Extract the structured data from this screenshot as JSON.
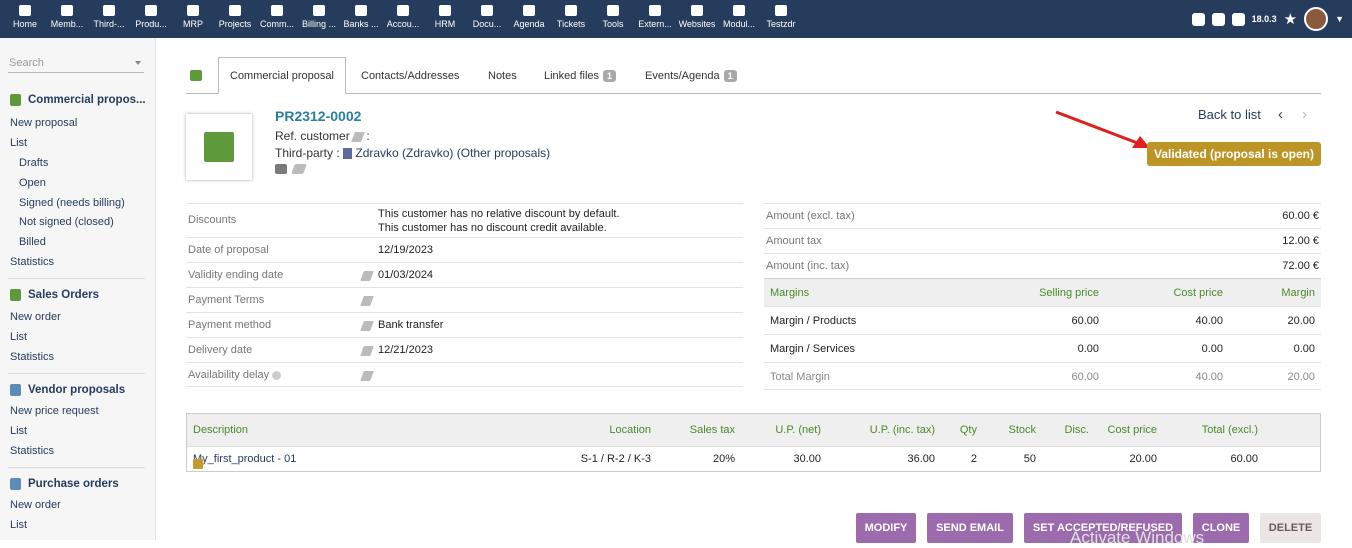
{
  "topmenu": [
    {
      "label": "Home",
      "icon": "home-icon"
    },
    {
      "label": "Memb...",
      "icon": "member-icon"
    },
    {
      "label": "Third-...",
      "icon": "building-icon"
    },
    {
      "label": "Produ...",
      "icon": "cube-icon"
    },
    {
      "label": "MRP",
      "icon": "cogs-icon"
    },
    {
      "label": "Projects",
      "icon": "sitemap-icon"
    },
    {
      "label": "Comm...",
      "icon": "suitcase-icon"
    },
    {
      "label": "Billing ...",
      "icon": "coins-icon"
    },
    {
      "label": "Banks ...",
      "icon": "bank-icon"
    },
    {
      "label": "Accou...",
      "icon": "search-dollar-icon"
    },
    {
      "label": "HRM",
      "icon": "user-tie-icon"
    },
    {
      "label": "Docu...",
      "icon": "folder-icon"
    },
    {
      "label": "Agenda",
      "icon": "calendar-icon"
    },
    {
      "label": "Tickets",
      "icon": "ticket-icon"
    },
    {
      "label": "Tools",
      "icon": "wrench-icon"
    },
    {
      "label": "Extern...",
      "icon": "external-link-icon"
    },
    {
      "label": "Websites",
      "icon": "globe-icon"
    },
    {
      "label": "Modul...",
      "icon": "module-icon"
    },
    {
      "label": "Testzdr",
      "icon": "box-icon"
    }
  ],
  "topright": {
    "version": "18.0.3"
  },
  "sidebar": {
    "search_placeholder": "Search",
    "sections": [
      {
        "title": "Commercial propos...",
        "items": [
          "New proposal",
          "List"
        ],
        "subitems": [
          "Drafts",
          "Open",
          "Signed (needs billing)",
          "Not signed (closed)",
          "Billed"
        ],
        "extra": [
          "Statistics"
        ]
      },
      {
        "title": "Sales Orders",
        "items": [
          "New order",
          "List",
          "Statistics"
        ]
      },
      {
        "title": "Vendor proposals",
        "items": [
          "New price request",
          "List",
          "Statistics"
        ]
      },
      {
        "title": "Purchase orders",
        "items": [
          "New order",
          "List"
        ]
      }
    ]
  },
  "tabs": {
    "commercial": "Commercial proposal",
    "contacts": "Contacts/Addresses",
    "notes": "Notes",
    "linked": "Linked files",
    "linked_count": "1",
    "events": "Events/Agenda",
    "events_count": "1"
  },
  "header": {
    "ref": "PR2312-0002",
    "ref_customer_label": "Ref. customer",
    "ref_customer_colon": ":",
    "thirdparty_label": "Third-party :",
    "thirdparty_name": "Zdravko (Zdravko)",
    "other_proposals": "(Other proposals)",
    "back_to_list": "Back to list",
    "status": "Validated (proposal is open)"
  },
  "fields": {
    "discounts_label": "Discounts",
    "discounts_line1": "This customer has no relative discount by default.",
    "discounts_line2": "This customer has no discount credit available.",
    "date_label": "Date of proposal",
    "date_value": "12/19/2023",
    "validity_label": "Validity ending date",
    "validity_value": "01/03/2024",
    "payment_terms_label": "Payment Terms",
    "payment_method_label": "Payment method",
    "payment_method_value": "Bank transfer",
    "delivery_label": "Delivery date",
    "delivery_value": "12/21/2023",
    "availability_label": "Availability delay"
  },
  "amounts": {
    "excl_label": "Amount (excl. tax)",
    "excl_value": "60.00 €",
    "tax_label": "Amount tax",
    "tax_value": "12.00 €",
    "inc_label": "Amount (inc. tax)",
    "inc_value": "72.00 €"
  },
  "margins": {
    "head": {
      "label": "Margins",
      "selling": "Selling price",
      "cost": "Cost price",
      "margin": "Margin"
    },
    "products": {
      "label": "Margin / Products",
      "selling": "60.00",
      "cost": "40.00",
      "margin": "20.00"
    },
    "services": {
      "label": "Margin / Services",
      "selling": "0.00",
      "cost": "0.00",
      "margin": "0.00"
    },
    "total": {
      "label": "Total Margin",
      "selling": "60.00",
      "cost": "40.00",
      "margin": "20.00"
    }
  },
  "lines": {
    "headers": {
      "description": "Description",
      "location": "Location",
      "sales_tax": "Sales tax",
      "up_net": "U.P. (net)",
      "up_inc": "U.P. (inc. tax)",
      "qty": "Qty",
      "stock": "Stock",
      "disc": "Disc.",
      "cost": "Cost price",
      "total": "Total (excl.)"
    },
    "row": {
      "description": "My_first_product - 01",
      "location": "S-1 / R-2 / K-3",
      "sales_tax": "20%",
      "up_net": "30.00",
      "up_inc": "36.00",
      "qty": "2",
      "stock": "50",
      "disc": "",
      "cost": "20.00",
      "total": "60.00"
    }
  },
  "buttons": {
    "modify": "MODIFY",
    "send_email": "SEND EMAIL",
    "set_accepted": "SET ACCEPTED/REFUSED",
    "clone": "CLONE",
    "delete": "DELETE"
  },
  "watermark": "Activate Windows",
  "colors": {
    "topbar": "#263c5c",
    "status": "#bc9526",
    "button": "#9b6bad",
    "green": "#4a8a2a",
    "link": "#2a7fa0"
  }
}
